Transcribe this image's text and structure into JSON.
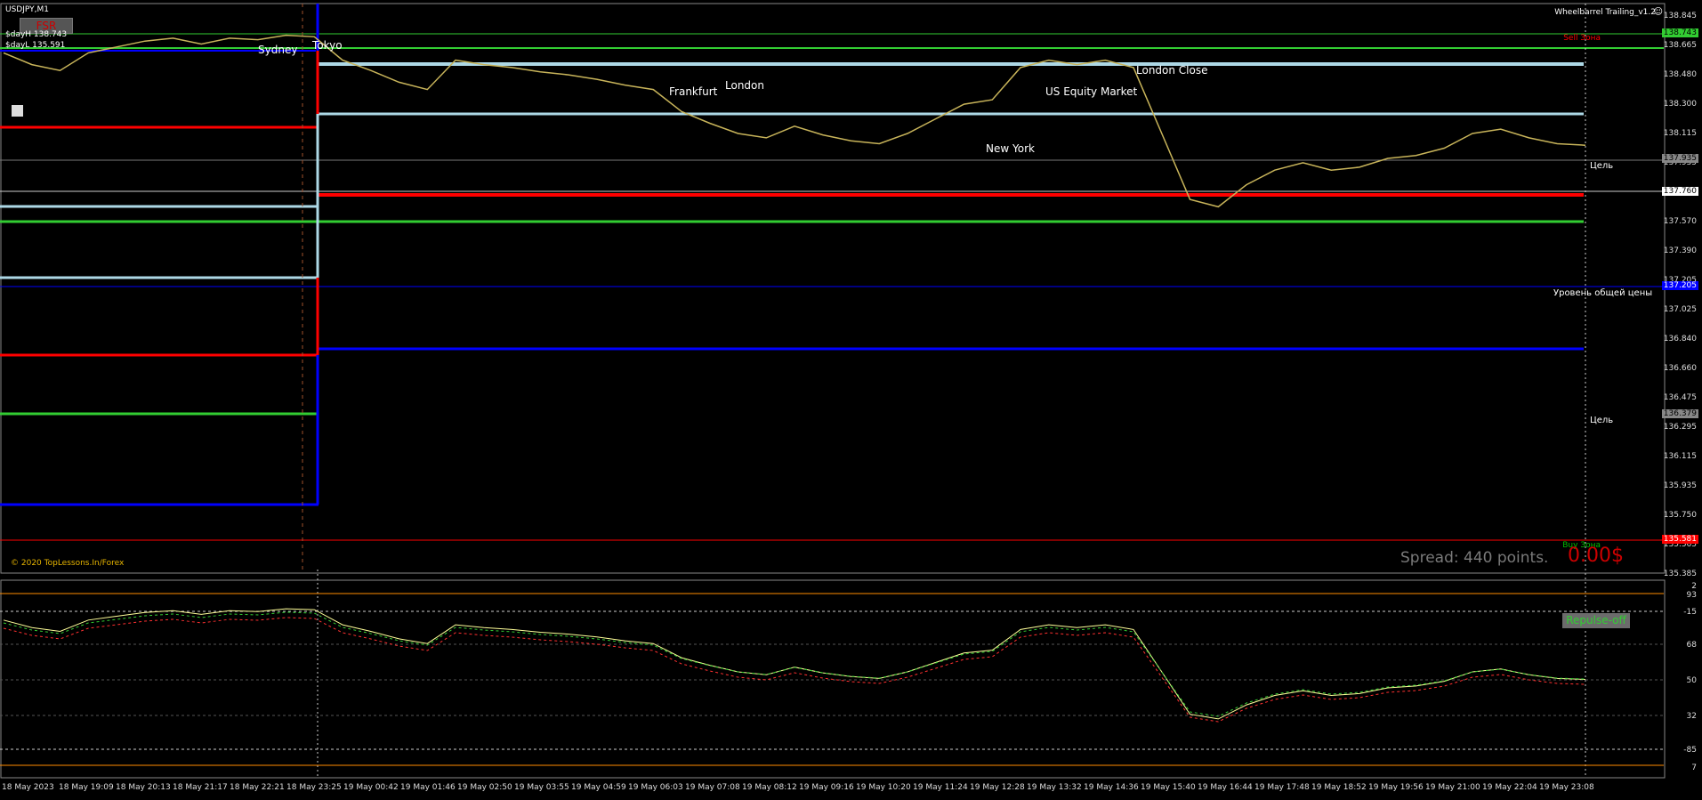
{
  "window": {
    "symbol": "USDJPY,M1",
    "ea_name": "Wheelbarrel Trailing_v1.2"
  },
  "fsr_button": "FSR",
  "day_high": "$dayH 138.743",
  "day_low": "$dayL 135.591",
  "sessions": [
    "Sydney",
    "Tokyo",
    "Frankfurt",
    "London",
    "US Equity Market",
    "London Close",
    "New York"
  ],
  "zones": {
    "sell": "Sell Зона",
    "buy": "Buy Зона"
  },
  "targets": [
    "Цель",
    "Цель"
  ],
  "common_level": "Уровень общей цены",
  "copyright": "© 2020 TopLessons.In/Forex",
  "spread": "Spread: 440 points.",
  "profit": "0.00$",
  "repulse_button": "Repulse-off",
  "price_axis": [
    "138.845",
    "138.665",
    "138.480",
    "138.300",
    "138.115",
    "137.935",
    "137.760",
    "137.570",
    "137.390",
    "137.205",
    "137.025",
    "136.840",
    "136.660",
    "136.475",
    "136.295",
    "136.115",
    "135.935",
    "135.750",
    "135.565",
    "135.385"
  ],
  "price_tags": {
    "top_green": "138.743",
    "current": "137.935",
    "white": "137.760",
    "blue": "137.205",
    "gray": "136.379",
    "red": "135.581"
  },
  "ind_axis": [
    "2",
    "93",
    "-15",
    "68",
    "50",
    "32",
    "-85",
    "7"
  ],
  "time_axis": [
    "18 May 2023",
    "18 May 19:09",
    "18 May 20:13",
    "18 May 21:17",
    "18 May 22:21",
    "18 May 23:25",
    "19 May 00:42",
    "19 May 01:46",
    "19 May 02:50",
    "19 May 03:55",
    "19 May 04:59",
    "19 May 06:03",
    "19 May 07:08",
    "19 May 08:12",
    "19 May 09:16",
    "19 May 10:20",
    "19 May 11:24",
    "19 May 12:28",
    "19 May 13:32",
    "19 May 14:36",
    "19 May 15:40",
    "19 May 16:44",
    "19 May 17:48",
    "19 May 18:52",
    "19 May 19:56",
    "19 May 21:00",
    "19 May 22:04",
    "19 May 23:08"
  ],
  "colors": {
    "red": "#ff0000",
    "green": "#32cd32",
    "blue": "#0000ff",
    "lightblue": "#add8e6",
    "gold": "#e6b400",
    "orange": "#ff8c00"
  },
  "price_series": [
    138.6,
    138.52,
    138.48,
    138.6,
    138.64,
    138.68,
    138.7,
    138.66,
    138.7,
    138.69,
    138.72,
    138.71,
    138.55,
    138.48,
    138.4,
    138.35,
    138.55,
    138.52,
    138.5,
    138.47,
    138.45,
    138.42,
    138.38,
    138.35,
    138.2,
    138.12,
    138.05,
    138.02,
    138.1,
    138.04,
    138.0,
    137.98,
    138.05,
    138.15,
    138.25,
    138.28,
    138.5,
    138.55,
    138.52,
    138.55,
    138.5,
    138.05,
    137.6,
    137.55,
    137.7,
    137.8,
    137.85,
    137.8,
    137.82,
    137.88,
    137.9,
    137.95,
    138.05,
    138.08,
    138.02,
    137.98,
    137.97
  ]
}
